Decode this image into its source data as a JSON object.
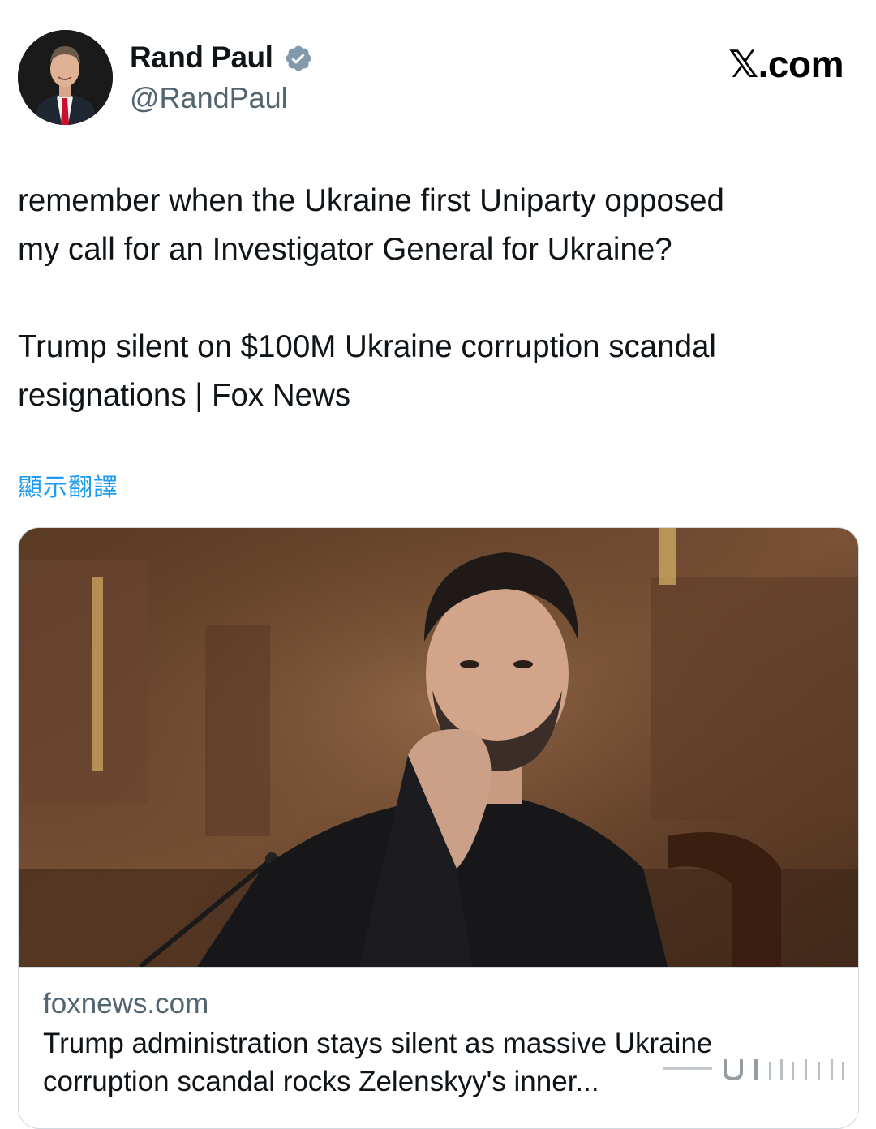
{
  "author": {
    "display_name": "Rand Paul",
    "handle": "@RandPaul",
    "verified_icon": "verified-badge-icon",
    "avatar_icon": "profile-photo"
  },
  "site": {
    "logo_text": "𝕏.com"
  },
  "tweet": {
    "text": "remember when the Ukraine first Uniparty opposed\nmy call for an Investigator General for Ukraine?\n\nTrump silent on $100M Ukraine corruption scandal\nresignations | Fox News",
    "translate_label": "顯示翻譯"
  },
  "link_card": {
    "domain": "foxnews.com",
    "title": "Trump administration stays silent as massive Ukraine corruption scandal rocks Zelenskyy's inner..."
  },
  "colors": {
    "link_blue": "#1d9bf0",
    "secondary_text": "#536471",
    "verified_badge": "#829aab",
    "border": "#cfd9de"
  }
}
